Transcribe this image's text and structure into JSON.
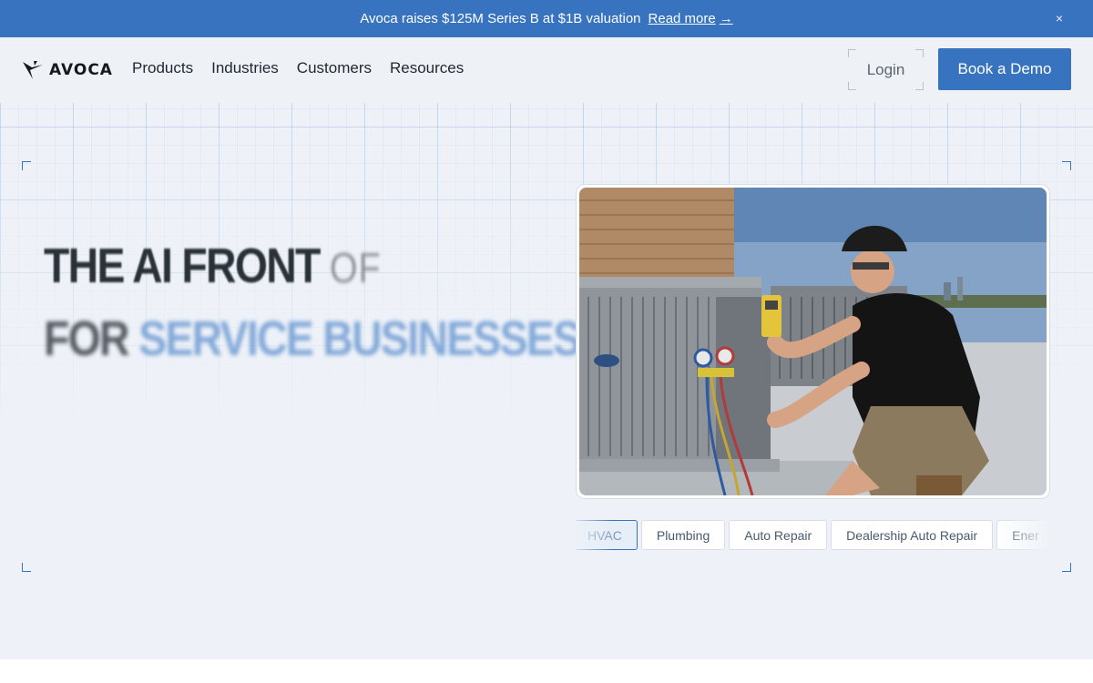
{
  "announcement": {
    "message": "Avoca raises $125M Series B at $1B valuation",
    "link_label": "Read more",
    "link_arrow": "→",
    "close_icon": "×"
  },
  "nav": {
    "logo_text": "AVOCA",
    "links": [
      "Products",
      "Industries",
      "Customers",
      "Resources"
    ],
    "login_label": "Login",
    "cta_label": "Book a Demo"
  },
  "hero": {
    "headline_line1": "THE AI FRONT",
    "headline_line1_partial": "OF",
    "headline_line2_prefix": "FOR",
    "headline_line2_accent": "SERVICE BUSINESSES",
    "image_alt": "technician-servicing-hvac-unit-photo",
    "industry_tabs": [
      "HVAC",
      "Plumbing",
      "Auto Repair",
      "Dealership Auto Repair",
      "Ener"
    ],
    "active_tab_index": 0
  },
  "colors": {
    "brand_blue": "#3773bf",
    "hero_bg": "#eef2f8"
  }
}
